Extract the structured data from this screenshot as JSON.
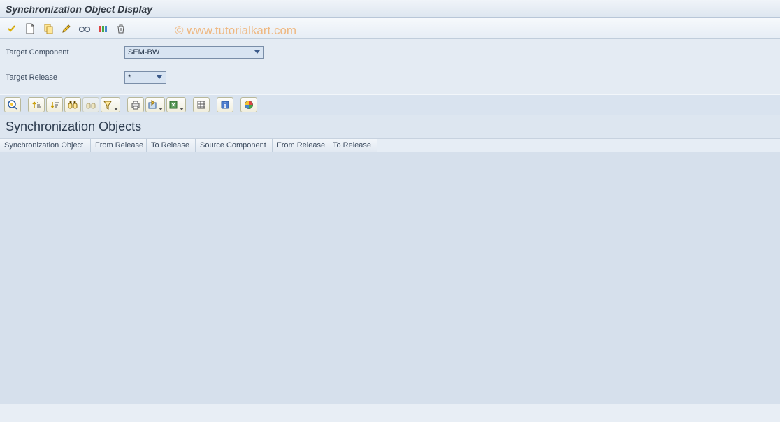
{
  "title": "Synchronization Object Display",
  "watermark": "© www.tutorialkart.com",
  "form": {
    "target_component_label": "Target Component",
    "target_component_value": "SEM-BW",
    "target_release_label": "Target Release",
    "target_release_value": "*"
  },
  "section_title": "Synchronization Objects",
  "columns": [
    "Synchronization Object",
    "From Release",
    "To Release",
    "Source Component",
    "From Release",
    "To Release"
  ],
  "toolbar_icons": [
    "check",
    "new",
    "copy",
    "edit",
    "glasses",
    "activate",
    "delete"
  ],
  "grid_toolbar_icons": [
    "details",
    "sort-asc",
    "sort-desc",
    "find",
    "find-next",
    "filter",
    "print",
    "export",
    "spreadsheet",
    "layout",
    "info",
    "chart"
  ]
}
